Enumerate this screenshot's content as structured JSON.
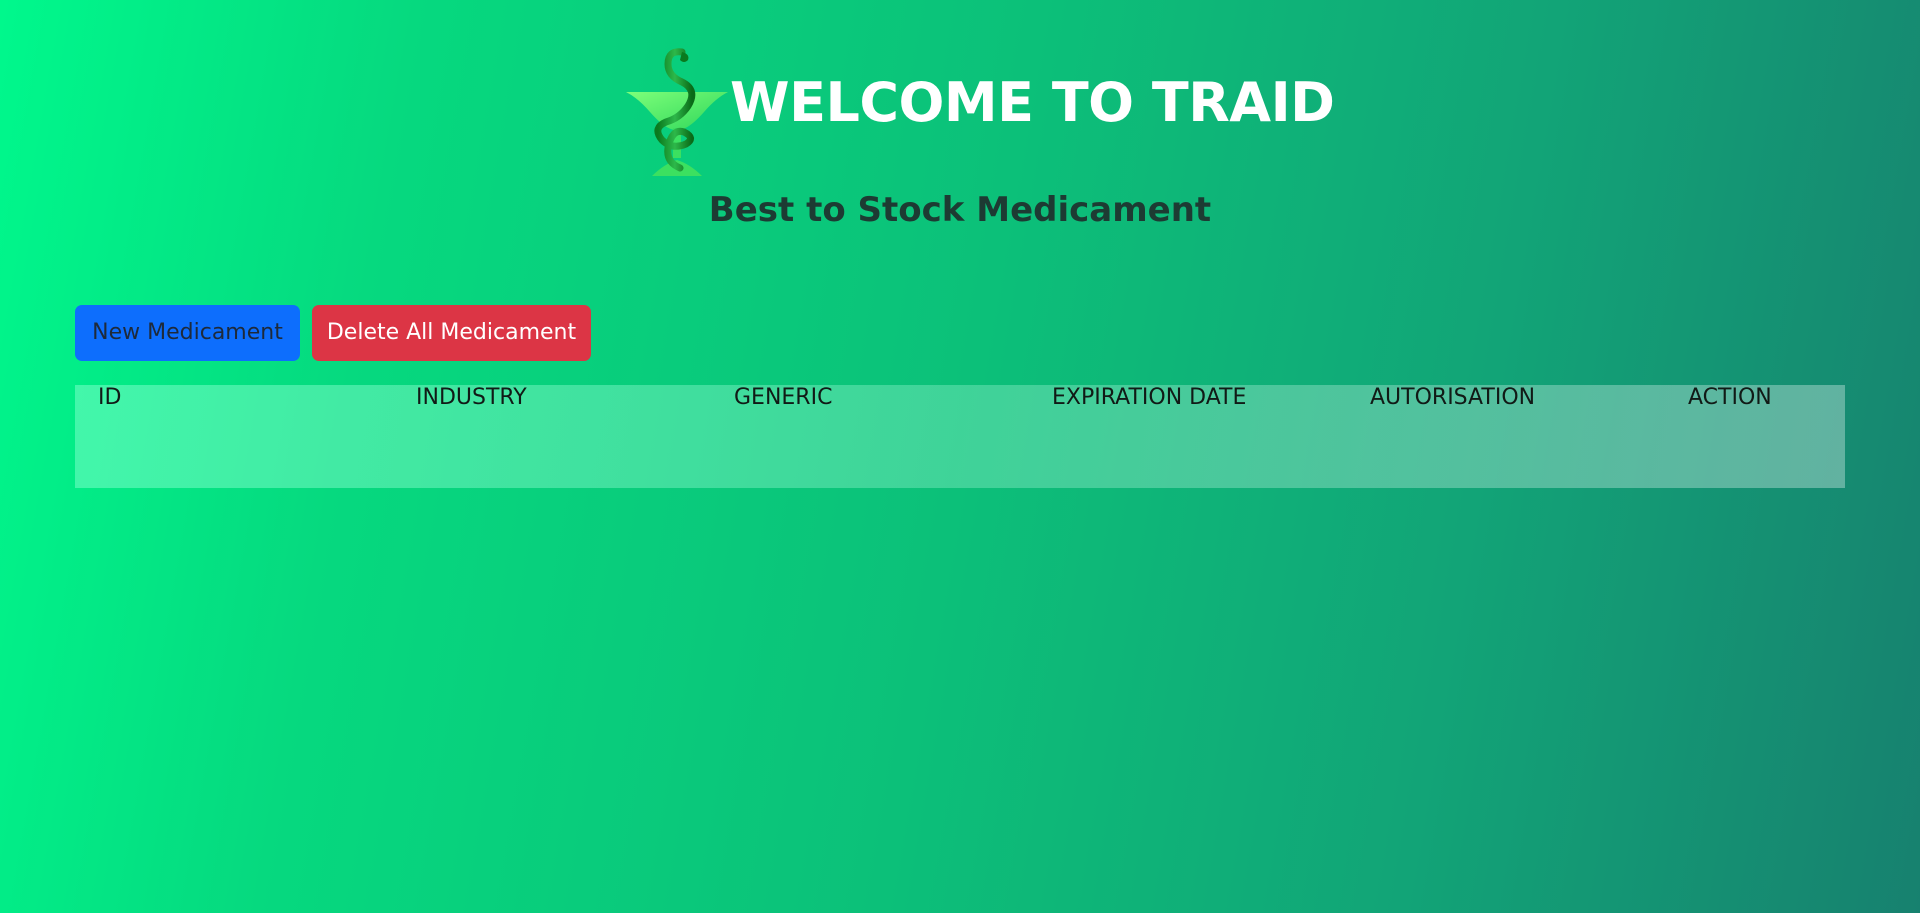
{
  "header": {
    "logo_icon": "bowl-of-hygieia-icon",
    "title": "WELCOME TO TRAID",
    "subtitle": "Best to Stock Medicament"
  },
  "toolbar": {
    "new_label": "New Medicament",
    "delete_all_label": "Delete All Medicament"
  },
  "table": {
    "columns": [
      "ID",
      "INDUSTRY",
      "GENERIC",
      "EXPIRATION DATE",
      "AUTORISATION",
      "ACTION"
    ],
    "rows": []
  },
  "colors": {
    "primary_button": "#0d6efd",
    "danger_button": "#dc3545",
    "title_text": "#ffffff",
    "subtitle_text": "#1d3b33"
  }
}
